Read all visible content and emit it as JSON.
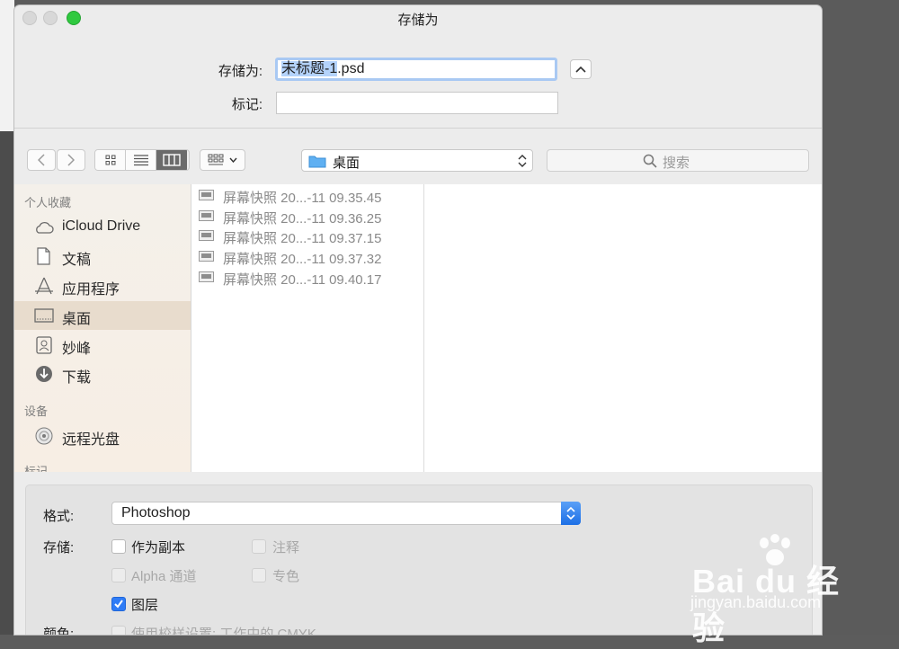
{
  "window": {
    "title": "存储为"
  },
  "save_form": {
    "save_as_label": "存储为:",
    "filename_selected": "未标题-1",
    "filename_rest": ".psd",
    "tags_label": "标记:",
    "tags_value": ""
  },
  "toolbar": {
    "location": "桌面",
    "search_placeholder": "搜索"
  },
  "sidebar": {
    "favorites_header": "个人收藏",
    "favorites": [
      {
        "label": "iCloud Drive",
        "icon": "cloud-icon"
      },
      {
        "label": "文稿",
        "icon": "document-icon"
      },
      {
        "label": "应用程序",
        "icon": "applications-icon"
      },
      {
        "label": "桌面",
        "icon": "desktop-icon",
        "selected": true
      },
      {
        "label": "妙峰",
        "icon": "home-icon"
      },
      {
        "label": "下载",
        "icon": "download-icon"
      }
    ],
    "devices_header": "设备",
    "devices": [
      {
        "label": "远程光盘",
        "icon": "disc-icon"
      }
    ],
    "tags_header": "标记"
  },
  "files": [
    "屏幕快照 20...-11 09.35.45",
    "屏幕快照 20...-11 09.36.25",
    "屏幕快照 20...-11 09.37.15",
    "屏幕快照 20...-11 09.37.32",
    "屏幕快照 20...-11 09.40.17"
  ],
  "options": {
    "format_label": "格式:",
    "format_value": "Photoshop",
    "save_label": "存储:",
    "as_copy": "作为副本",
    "annotations": "注释",
    "alpha_channels": "Alpha 通道",
    "spot_colors": "专色",
    "layers": "图层",
    "color_label": "颜色:",
    "use_proof_setup": "使用校样设置: 工作中的 CMYK"
  },
  "watermark": {
    "brand": "Bai du 经验",
    "url": "jingyan.baidu.com"
  }
}
